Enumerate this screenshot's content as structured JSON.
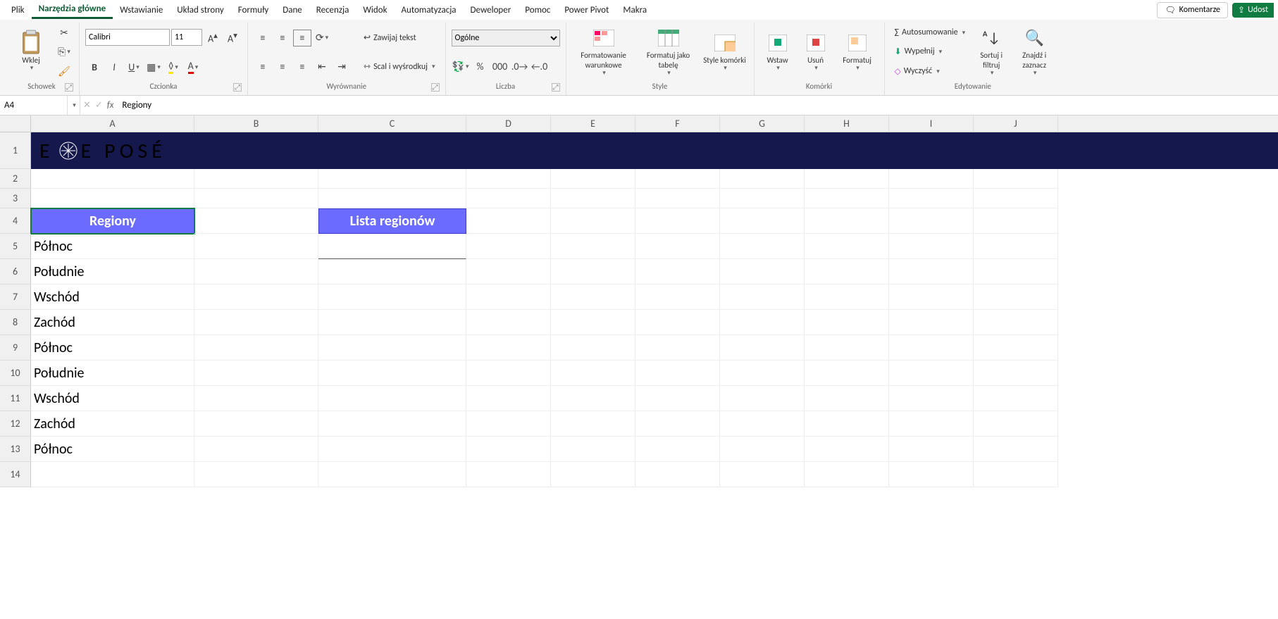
{
  "tabs": {
    "items": [
      "Plik",
      "Narzędzia główne",
      "Wstawianie",
      "Układ strony",
      "Formuły",
      "Dane",
      "Recenzja",
      "Widok",
      "Automatyzacja",
      "Deweloper",
      "Pomoc",
      "Power Pivot",
      "Makra"
    ],
    "active": 1,
    "comments": "Komentarze",
    "share": "Udost"
  },
  "ribbon": {
    "clipboard": {
      "paste": "Wklej",
      "label": "Schowek"
    },
    "font": {
      "name": "Calibri",
      "size": "11",
      "bold": "B",
      "italic": "I",
      "underline": "U",
      "label": "Czcionka"
    },
    "alignment": {
      "wrap": "Zawijaj tekst",
      "merge": "Scal i wyśrodkuj",
      "label": "Wyrównanie"
    },
    "number": {
      "format": "Ogólne",
      "label": "Liczba"
    },
    "styles": {
      "condfmt": "Formatowanie warunkowe",
      "table": "Formatuj jako tabelę",
      "cellstyle": "Style komórki",
      "label": "Style"
    },
    "cells": {
      "insert": "Wstaw",
      "delete": "Usuń",
      "format": "Formatuj",
      "label": "Komórki"
    },
    "editing": {
      "autosum": "Autosumowanie",
      "fill": "Wypełnij",
      "clear": "Wyczyść",
      "sort": "Sortuj i filtruj",
      "find": "Znajdź i zaznacz",
      "label": "Edytowanie"
    }
  },
  "formula_bar": {
    "name_box": "A4",
    "formula": "Regiony"
  },
  "grid": {
    "columns": [
      "A",
      "B",
      "C",
      "D",
      "E",
      "F",
      "G",
      "H",
      "I",
      "J"
    ],
    "row_numbers": [
      1,
      2,
      3,
      4,
      5,
      6,
      7,
      8,
      9,
      10,
      11,
      12,
      13,
      14
    ],
    "logo_text": "E POSÉ",
    "header_a4": "Regiony",
    "header_c4": "Lista regionów",
    "data_a": [
      "Północ",
      "Południe",
      "Wschód",
      "Zachód",
      "Północ",
      "Południe",
      "Wschód",
      "Zachód",
      "Północ"
    ]
  }
}
